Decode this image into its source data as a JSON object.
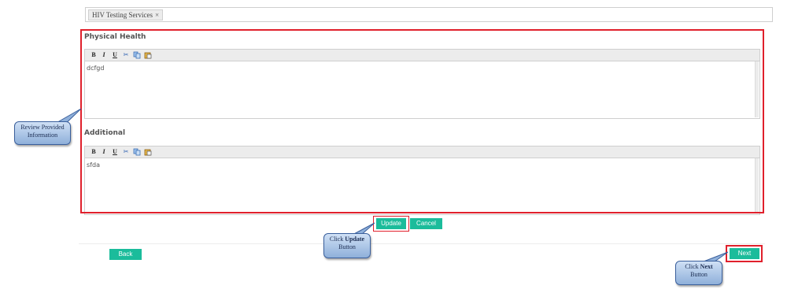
{
  "services": {
    "tag_label": "HIV Testing Services",
    "remove_symbol": "×"
  },
  "sections": [
    {
      "title": "Physical Health",
      "content": "dcfgd"
    },
    {
      "title": "Additional",
      "content": "sfda"
    }
  ],
  "toolbar": {
    "bold": "B",
    "italic": "I",
    "underline": "U"
  },
  "buttons": {
    "update": "Update",
    "cancel": "Cancel",
    "back": "Back",
    "next": "Next"
  },
  "callouts": {
    "review_line1": "Review Provided",
    "review_line2": "Information",
    "update_prefix": "Click ",
    "update_bold": "Update",
    "update_line2": "Button",
    "next_prefix": "Click ",
    "next_bold": "Next",
    "next_line2": "Button"
  },
  "colors": {
    "button_teal": "#1bbc9b",
    "highlight_red": "#e0202c",
    "callout_blue": "#8fb0da"
  }
}
